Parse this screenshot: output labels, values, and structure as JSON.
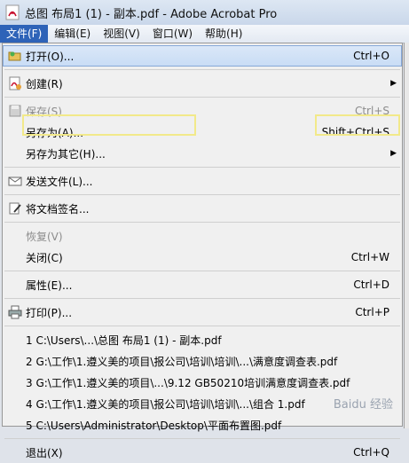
{
  "window": {
    "title": "总图 布局1 (1) - 副本.pdf - Adobe Acrobat Pro"
  },
  "menubar": {
    "items": [
      "文件(F)",
      "编辑(E)",
      "视图(V)",
      "窗口(W)",
      "帮助(H)"
    ]
  },
  "file_menu": {
    "open": {
      "label": "打开(O)...",
      "shortcut": "Ctrl+O"
    },
    "create": {
      "label": "创建(R)"
    },
    "save": {
      "label": "保存(S)",
      "shortcut": "Ctrl+S"
    },
    "save_as": {
      "label": "另存为(A)...",
      "shortcut": "Shift+Ctrl+S"
    },
    "save_as_other": {
      "label": "另存为其它(H)..."
    },
    "send_file": {
      "label": "发送文件(L)..."
    },
    "sign": {
      "label": "将文档签名..."
    },
    "revert": {
      "label": "恢复(V)"
    },
    "close": {
      "label": "关闭(C)",
      "shortcut": "Ctrl+W"
    },
    "properties": {
      "label": "属性(E)...",
      "shortcut": "Ctrl+D"
    },
    "print": {
      "label": "打印(P)...",
      "shortcut": "Ctrl+P"
    },
    "recent": [
      "1 C:\\Users\\...\\总图 布局1 (1) - 副本.pdf",
      "2 G:\\工作\\1.遵义美的项目\\报公司\\培训\\培训\\...\\满意度调查表.pdf",
      "3 G:\\工作\\1.遵义美的项目\\...\\9.12  GB50210培训满意度调查表.pdf",
      "4 G:\\工作\\1.遵义美的项目\\报公司\\培训\\培训\\...\\组合 1.pdf",
      "5 C:\\Users\\Administrator\\Desktop\\平面布置图.pdf"
    ],
    "exit": {
      "label": "退出(X)",
      "shortcut": "Ctrl+Q"
    }
  },
  "watermark": "Baidu 经验"
}
